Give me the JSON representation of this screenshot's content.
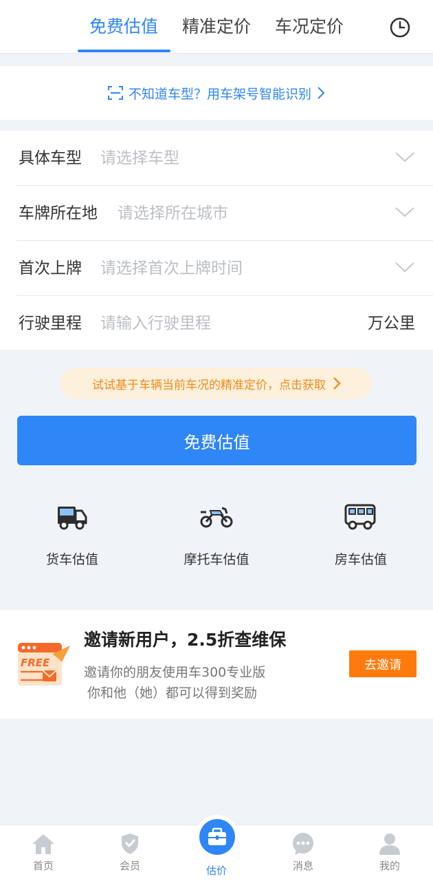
{
  "top_tabs": [
    {
      "label": "免费估值",
      "active": true
    },
    {
      "label": "精准定价",
      "active": false
    },
    {
      "label": "车况定价",
      "active": false
    }
  ],
  "vin_banner": {
    "text": "不知道车型？用车架号智能识别"
  },
  "form": {
    "rows": [
      {
        "label": "具体车型",
        "placeholder": "请选择车型",
        "type": "select"
      },
      {
        "label": "车牌所在地",
        "placeholder": "请选择所在城市",
        "type": "select"
      },
      {
        "label": "首次上牌",
        "placeholder": "请选择首次上牌时间",
        "type": "select"
      },
      {
        "label": "行驶里程",
        "placeholder": "请输入行驶里程",
        "unit": "万公里",
        "type": "input"
      }
    ]
  },
  "tip": {
    "text": "试试基于车辆当前车况的精准定价，点击获取"
  },
  "main_button": {
    "label": "免费估值"
  },
  "categories": [
    {
      "label": "货车估值",
      "icon": "truck-icon"
    },
    {
      "label": "摩托车估值",
      "icon": "motorcycle-icon"
    },
    {
      "label": "房车估值",
      "icon": "rv-icon"
    }
  ],
  "invite": {
    "title": "邀请新用户，2.5折查维保",
    "desc1": "邀请你的朋友使用车300专业版",
    "desc2": "你和他（她）都可以得到奖励",
    "button": "去邀请",
    "image_text": "FREE"
  },
  "bottom_nav": [
    {
      "label": "首页",
      "icon": "home-icon"
    },
    {
      "label": "会员",
      "icon": "member-icon"
    },
    {
      "label": "估价",
      "icon": "briefcase-icon",
      "active": true
    },
    {
      "label": "消息",
      "icon": "message-icon"
    },
    {
      "label": "我的",
      "icon": "user-icon"
    }
  ],
  "colors": {
    "accent": "#2f86f6",
    "orange": "#ff7a0c",
    "tip_text": "#f08a1a"
  }
}
